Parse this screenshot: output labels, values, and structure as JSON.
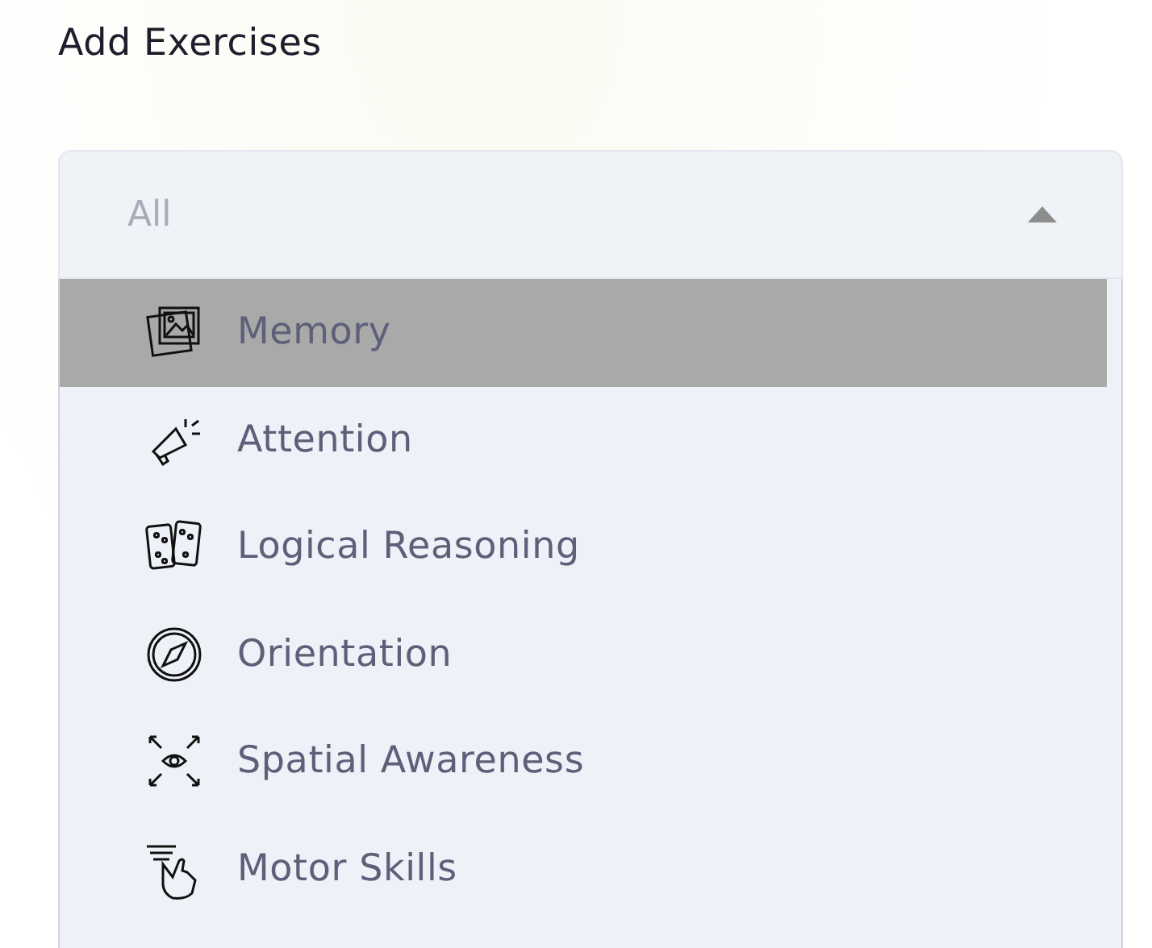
{
  "title": "Add Exercises",
  "select": {
    "value": "All",
    "expanded": true
  },
  "options": [
    {
      "label": "Memory",
      "selected": true
    },
    {
      "label": "Attention",
      "selected": false
    },
    {
      "label": "Logical Reasoning",
      "selected": false
    },
    {
      "label": "Orientation",
      "selected": false
    },
    {
      "label": "Spatial Awareness",
      "selected": false
    },
    {
      "label": "Motor Skills",
      "selected": false
    }
  ]
}
